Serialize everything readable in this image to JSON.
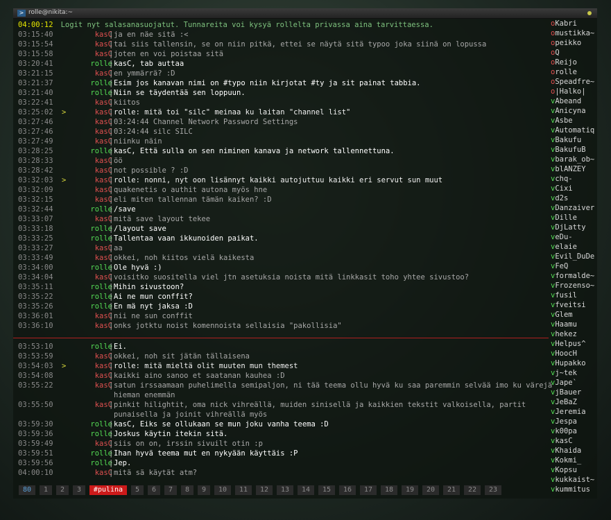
{
  "window": {
    "title": "rolle@nikita:~",
    "icon": "terminal-icon"
  },
  "topic": {
    "time": "04:00:12",
    "text": "Logit nyt salasanasuojatut. Tunnareita voi kysyä rollelta privassa aina tarvittaessa."
  },
  "colors": {
    "kasC": "#e05050",
    "rolle": "#55dd55",
    "timestamp": "#8a8a8a",
    "marker_line": "#b02020",
    "active_window": "#cc1a1a"
  },
  "messages": [
    {
      "time": "03:15:40",
      "nick": "kasC",
      "text": "ja en näe sitä :<"
    },
    {
      "time": "03:15:54",
      "nick": "kasC",
      "text": "tai siis tallensin, se on niin pitkä, ettei se näytä sitä typoo joka siinä on lopussa"
    },
    {
      "time": "03:15:58",
      "nick": "kasC",
      "text": "joten en voi poistaa sitä"
    },
    {
      "time": "03:20:41",
      "nick": "rolle",
      "text": "kasC, tab auttaa"
    },
    {
      "time": "03:21:15",
      "nick": "kasC",
      "text": "en ymmärrä? :D"
    },
    {
      "time": "03:21:37",
      "nick": "rolle",
      "text": "Esim jos kanavan nimi on #typo niin kirjotat #ty ja sit painat tabbia."
    },
    {
      "time": "03:21:40",
      "nick": "rolle",
      "text": "Niin se täydentää sen loppuun."
    },
    {
      "time": "03:22:41",
      "nick": "kasC",
      "text": "kiitos"
    },
    {
      "time": "03:25:02",
      "nick": "kasC",
      "marker": ">",
      "text": "rolle: mitä toi \"silc\" meinaa ku laitan \"channel list\""
    },
    {
      "time": "03:27:46",
      "nick": "kasC",
      "text": "03:24:44 Channel          Network    Password  Settings"
    },
    {
      "time": "03:27:46",
      "nick": "kasC",
      "text": "03:24:44 silc             SILC"
    },
    {
      "time": "03:27:49",
      "nick": "kasC",
      "text": "niinku näin"
    },
    {
      "time": "03:28:25",
      "nick": "rolle",
      "text": "kasC, Että sulla on sen niminen kanava ja network tallennettuna."
    },
    {
      "time": "03:28:33",
      "nick": "kasC",
      "text": "öö"
    },
    {
      "time": "03:28:42",
      "nick": "kasC",
      "text": "not possible ? :D"
    },
    {
      "time": "03:32:03",
      "nick": "kasC",
      "marker": ">",
      "text": "rolle: nonni, nyt oon lisännyt kaikki autojuttuu kaikki eri servut sun muut"
    },
    {
      "time": "03:32:09",
      "nick": "kasC",
      "text": "quakenetis o authit autona myös hne"
    },
    {
      "time": "03:32:15",
      "nick": "kasC",
      "text": "eli miten tallennan tämän kaiken? :D"
    },
    {
      "time": "03:32:44",
      "nick": "rolle",
      "text": " /save"
    },
    {
      "time": "03:33:07",
      "nick": "kasC",
      "text": "mitä save layout tekee"
    },
    {
      "time": "03:33:18",
      "nick": "rolle",
      "text": " /layout save"
    },
    {
      "time": "03:33:25",
      "nick": "rolle",
      "text": "Tallentaa vaan ikkunoiden paikat."
    },
    {
      "time": "03:33:27",
      "nick": "kasC",
      "text": "aa"
    },
    {
      "time": "03:33:49",
      "nick": "kasC",
      "text": "okkei, noh kiitos vielä kaikesta"
    },
    {
      "time": "03:34:00",
      "nick": "rolle",
      "text": "Ole hyvä :)"
    },
    {
      "time": "03:34:04",
      "nick": "kasC",
      "text": "voisitko suositella viel jtn asetuksia noista mitä linkkasit toho yhtee sivustoo?"
    },
    {
      "time": "03:35:11",
      "nick": "rolle",
      "text": "Mihin sivustoon?"
    },
    {
      "time": "03:35:22",
      "nick": "rolle",
      "text": "Ai ne mun conffit?"
    },
    {
      "time": "03:35:26",
      "nick": "rolle",
      "text": "En mä nyt jaksa :D"
    },
    {
      "time": "03:36:01",
      "nick": "kasC",
      "text": "nii ne sun conffit"
    },
    {
      "time": "03:36:10",
      "nick": "kasC",
      "text": "onks jotktu noist komennoista sellaisia \"pakollisia\""
    },
    {
      "time": "03:53:10",
      "nick": "rolle",
      "text": "Ei."
    },
    {
      "time": "03:53:59",
      "nick": "kasC",
      "text": "okkei, noh sit jätän tällaisena"
    },
    {
      "time": "03:54:03",
      "nick": "kasC",
      "marker": ">",
      "text": "rolle: mitä mieltä olit muuten mun themest"
    },
    {
      "time": "03:54:08",
      "nick": "kasC",
      "text": "kaikki aino sanoo et saatanan kauhea :D"
    },
    {
      "time": "03:55:22",
      "nick": "kasC",
      "text": "satun irssaamaan puhelimella semipaljon, ni tää teema ollu hyvä ku saa paremmin selvää imo ku värejä",
      "cont": "hieman enemmän"
    },
    {
      "time": "03:55:50",
      "nick": "kasC",
      "text": "pinkit hilightit, oma nick vihreällä, muiden sinisellä ja kaikkien tekstit valkoisella, partit",
      "cont": "punaisella ja joinit vihreällä myös"
    },
    {
      "time": "03:59:30",
      "nick": "rolle",
      "text": "kasC, Eiks se ollukaan se mun joku vanha teema :D"
    },
    {
      "time": "03:59:36",
      "nick": "rolle",
      "text": "Joskus käytin itekin sitä."
    },
    {
      "time": "03:59:49",
      "nick": "kasC",
      "text": "siis on on, irssin sivuilt otin :p"
    },
    {
      "time": "03:59:51",
      "nick": "rolle",
      "text": "Ihan hyvä teema mut en nykyään käyttäis :P"
    },
    {
      "time": "03:59:56",
      "nick": "rolle",
      "text": "Jep."
    },
    {
      "time": "04:00:10",
      "nick": "kasC",
      "text": "mitä sä käytät atm?"
    }
  ],
  "nicklist": [
    {
      "prefix": "o",
      "name": "Kabri"
    },
    {
      "prefix": "o",
      "name": "mustikka~"
    },
    {
      "prefix": "o",
      "name": "peikko"
    },
    {
      "prefix": "o",
      "name": "Q"
    },
    {
      "prefix": "o",
      "name": "Reijo"
    },
    {
      "prefix": "o",
      "name": "rolle"
    },
    {
      "prefix": "o",
      "name": "Speadfre~"
    },
    {
      "prefix": "o",
      "name": "|Halko|"
    },
    {
      "prefix": "v",
      "name": "Abeand"
    },
    {
      "prefix": "v",
      "name": "Anicyna"
    },
    {
      "prefix": "v",
      "name": "Asbe"
    },
    {
      "prefix": "v",
      "name": "Automatiq"
    },
    {
      "prefix": "v",
      "name": "Bakufu"
    },
    {
      "prefix": "v",
      "name": "BakufuB"
    },
    {
      "prefix": "v",
      "name": "barak_ob~"
    },
    {
      "prefix": "v",
      "name": "blANZEY"
    },
    {
      "prefix": "v",
      "name": "chq-"
    },
    {
      "prefix": "v",
      "name": "Cixi"
    },
    {
      "prefix": "v",
      "name": "d2s"
    },
    {
      "prefix": "v",
      "name": "Danzaiver"
    },
    {
      "prefix": "v",
      "name": "Dille"
    },
    {
      "prefix": "v",
      "name": "DjLatty"
    },
    {
      "prefix": "v",
      "name": "eDu-"
    },
    {
      "prefix": "v",
      "name": "elaie"
    },
    {
      "prefix": "v",
      "name": "Evil_DuDe"
    },
    {
      "prefix": "v",
      "name": "FeQ"
    },
    {
      "prefix": "v",
      "name": "formalde~"
    },
    {
      "prefix": "v",
      "name": "Frozenso~"
    },
    {
      "prefix": "v",
      "name": "fusil"
    },
    {
      "prefix": "v",
      "name": "fveitsi"
    },
    {
      "prefix": "v",
      "name": "Glem"
    },
    {
      "prefix": "v",
      "name": "Haamu"
    },
    {
      "prefix": "v",
      "name": "hekez"
    },
    {
      "prefix": "v",
      "name": "Helpus^"
    },
    {
      "prefix": "v",
      "name": "HoocH"
    },
    {
      "prefix": "v",
      "name": "Hupakko"
    },
    {
      "prefix": "v",
      "name": "j~tek"
    },
    {
      "prefix": "v",
      "name": "Jape`"
    },
    {
      "prefix": "v",
      "name": "jBauer"
    },
    {
      "prefix": "v",
      "name": "JeBaZ"
    },
    {
      "prefix": "v",
      "name": "Jeremia"
    },
    {
      "prefix": "v",
      "name": "Jespa"
    },
    {
      "prefix": "v",
      "name": "k00pa"
    },
    {
      "prefix": "v",
      "name": "kasC"
    },
    {
      "prefix": "v",
      "name": "Khaida"
    },
    {
      "prefix": "v",
      "name": "Kokmi_"
    },
    {
      "prefix": "v",
      "name": "Kopsu"
    },
    {
      "prefix": "v",
      "name": "kukkaist~"
    },
    {
      "prefix": "v",
      "name": "kummitus"
    }
  ],
  "statusbar": {
    "windows": [
      "80",
      "1",
      "2",
      "3",
      "#pulina",
      "5",
      "6",
      "7",
      "8",
      "9",
      "10",
      "11",
      "12",
      "13",
      "14",
      "15",
      "16",
      "17",
      "18",
      "19",
      "20",
      "21",
      "22",
      "23"
    ],
    "active": "#pulina"
  }
}
